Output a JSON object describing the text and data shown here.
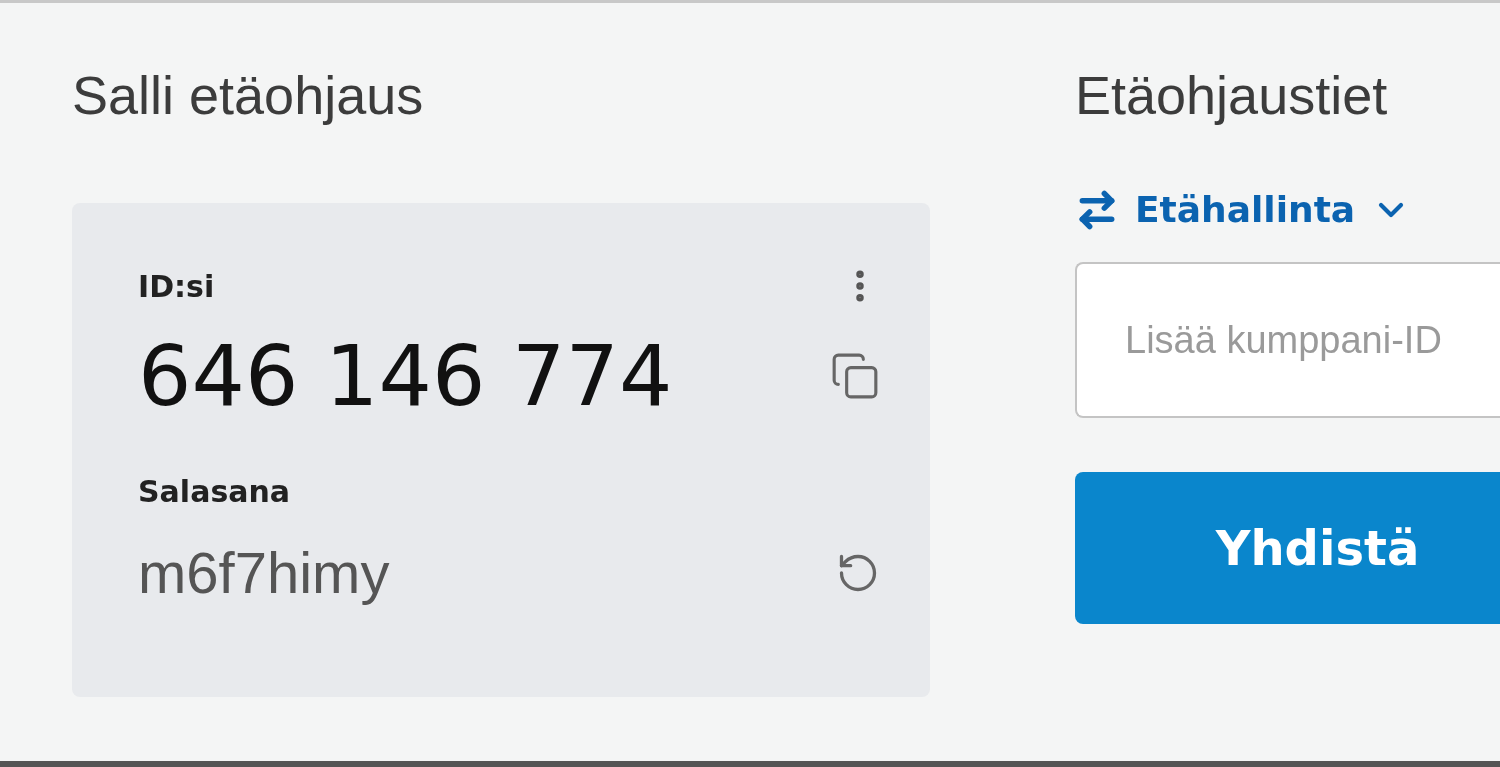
{
  "left": {
    "heading": "Salli etäohjaus",
    "card": {
      "id_label": "ID:si",
      "id_value": "646 146 774",
      "password_label": "Salasana",
      "password_value": "m6f7himy"
    }
  },
  "right": {
    "heading": "Etäohjaustiet",
    "mode_dropdown": {
      "label": "Etähallinta"
    },
    "partner_field": {
      "placeholder": "Lisää kumppani-ID"
    },
    "connect_button": {
      "label": "Yhdistä"
    }
  }
}
